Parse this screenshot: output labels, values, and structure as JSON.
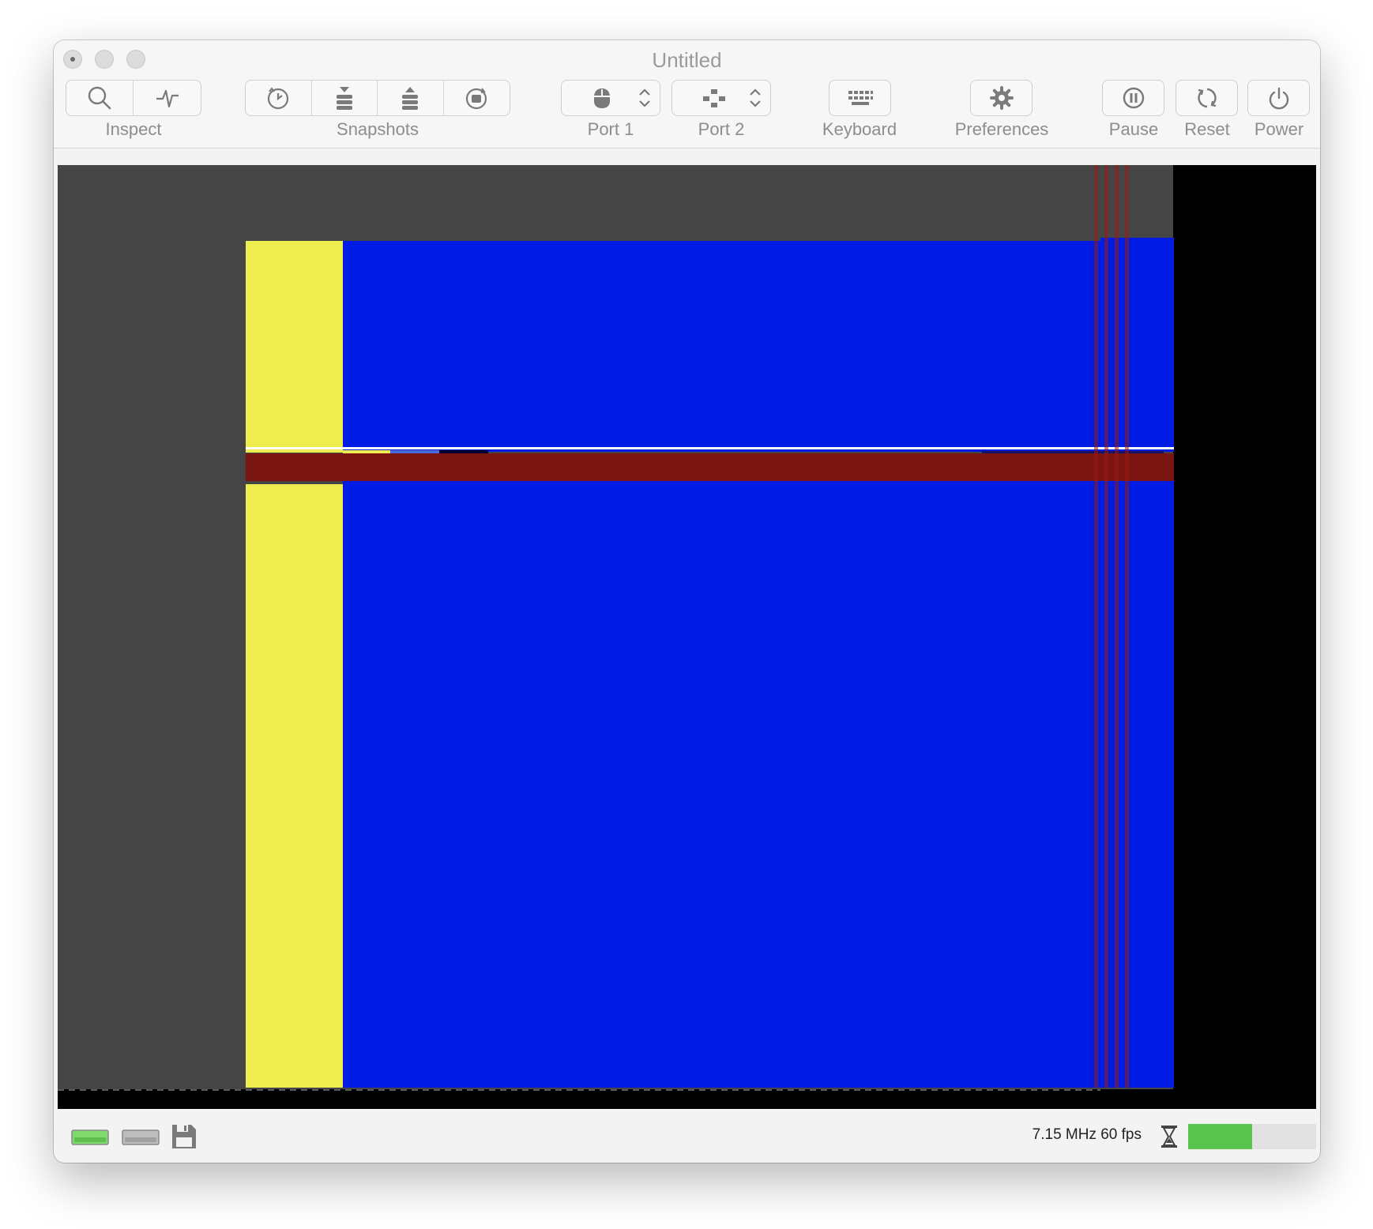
{
  "window": {
    "title": "Untitled"
  },
  "toolbar": {
    "inspect_label": "Inspect",
    "snapshots_label": "Snapshots",
    "port1_label": "Port 1",
    "port2_label": "Port 2",
    "keyboard_label": "Keyboard",
    "preferences_label": "Preferences",
    "pause_label": "Pause",
    "reset_label": "Reset",
    "power_label": "Power"
  },
  "icons": {
    "inspect": [
      "magnifier-icon",
      "activity-icon"
    ],
    "snapshots": [
      "history-icon",
      "take-snapshot-icon",
      "restore-snapshot-icon",
      "snapshot-browser-icon"
    ],
    "port1": "mouse-icon",
    "port2": "joystick-icon",
    "keyboard": "keyboard-icon",
    "preferences": "gear-icon",
    "pause": "pause-icon",
    "reset": "reset-icon",
    "power": "power-icon"
  },
  "colors": {
    "emulator_background": "#454545",
    "yellow": "#eeed4f",
    "blue": "#001be3",
    "red": "#7a1511",
    "black": "#000000",
    "speed_fill": "#5ac44f",
    "drive_led_active": "#7fd96b"
  },
  "status": {
    "speed_text": "7.15 MHz 60 fps",
    "speed_level": 0.5,
    "drives": [
      "floppy-drive-0-icon",
      "floppy-drive-1-icon",
      "floppy-disk-icon"
    ]
  }
}
